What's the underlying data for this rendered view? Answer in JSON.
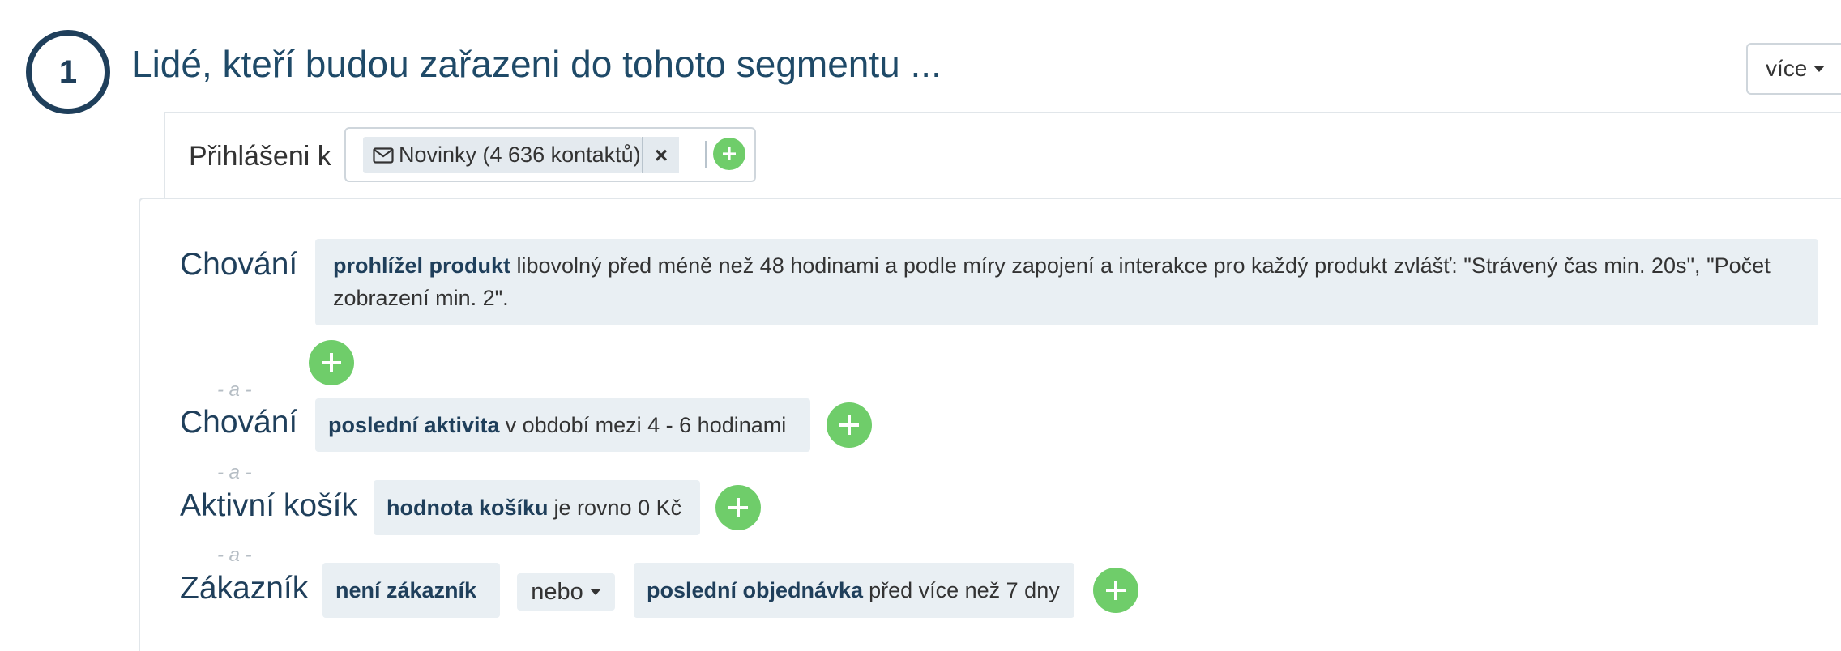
{
  "step": {
    "number": "1",
    "title": "Lidé, kteří budou zařazeni do tohoto segmentu ..."
  },
  "more_button": {
    "label": "více"
  },
  "subscription": {
    "label": "Přihlášeni k",
    "tag_label": "Novinky (4 636 kontaktů)",
    "remove_symbol": "×"
  },
  "and_separator": "- a -",
  "conditions": [
    {
      "label": "Chování",
      "items": [
        {
          "bold": "prohlížel produkt",
          "text": "libovolný před méně než 48 hodinami a podle míry zapojení a interakce pro každý produkt zvlášť: \"Strávený čas min. 20s\", \"Počet zobrazení min. 2\"."
        }
      ]
    },
    {
      "label": "Chování",
      "items": [
        {
          "bold": "poslední aktivita",
          "text": "v období mezi 4 - 6 hodinami"
        }
      ]
    },
    {
      "label": "Aktivní košík",
      "items": [
        {
          "bold": "hodnota košíku",
          "text": "je rovno 0 Kč"
        }
      ]
    },
    {
      "label": "Zákazník",
      "items": [
        {
          "bold": "není zákazník",
          "text": ""
        },
        {
          "bold": "poslední objednávka",
          "text": "před více než 7 dny"
        }
      ],
      "operator": "nebo"
    }
  ],
  "colors": {
    "primary_text": "#1f3f5b",
    "accent_green": "#6fcd6a",
    "condition_bg": "#e9eff3",
    "separator_text": "#b5bdc4"
  },
  "icons": {
    "add": "plus-icon",
    "tag": "mail-icon",
    "remove": "close-icon",
    "dropdown": "caret-down-icon"
  }
}
